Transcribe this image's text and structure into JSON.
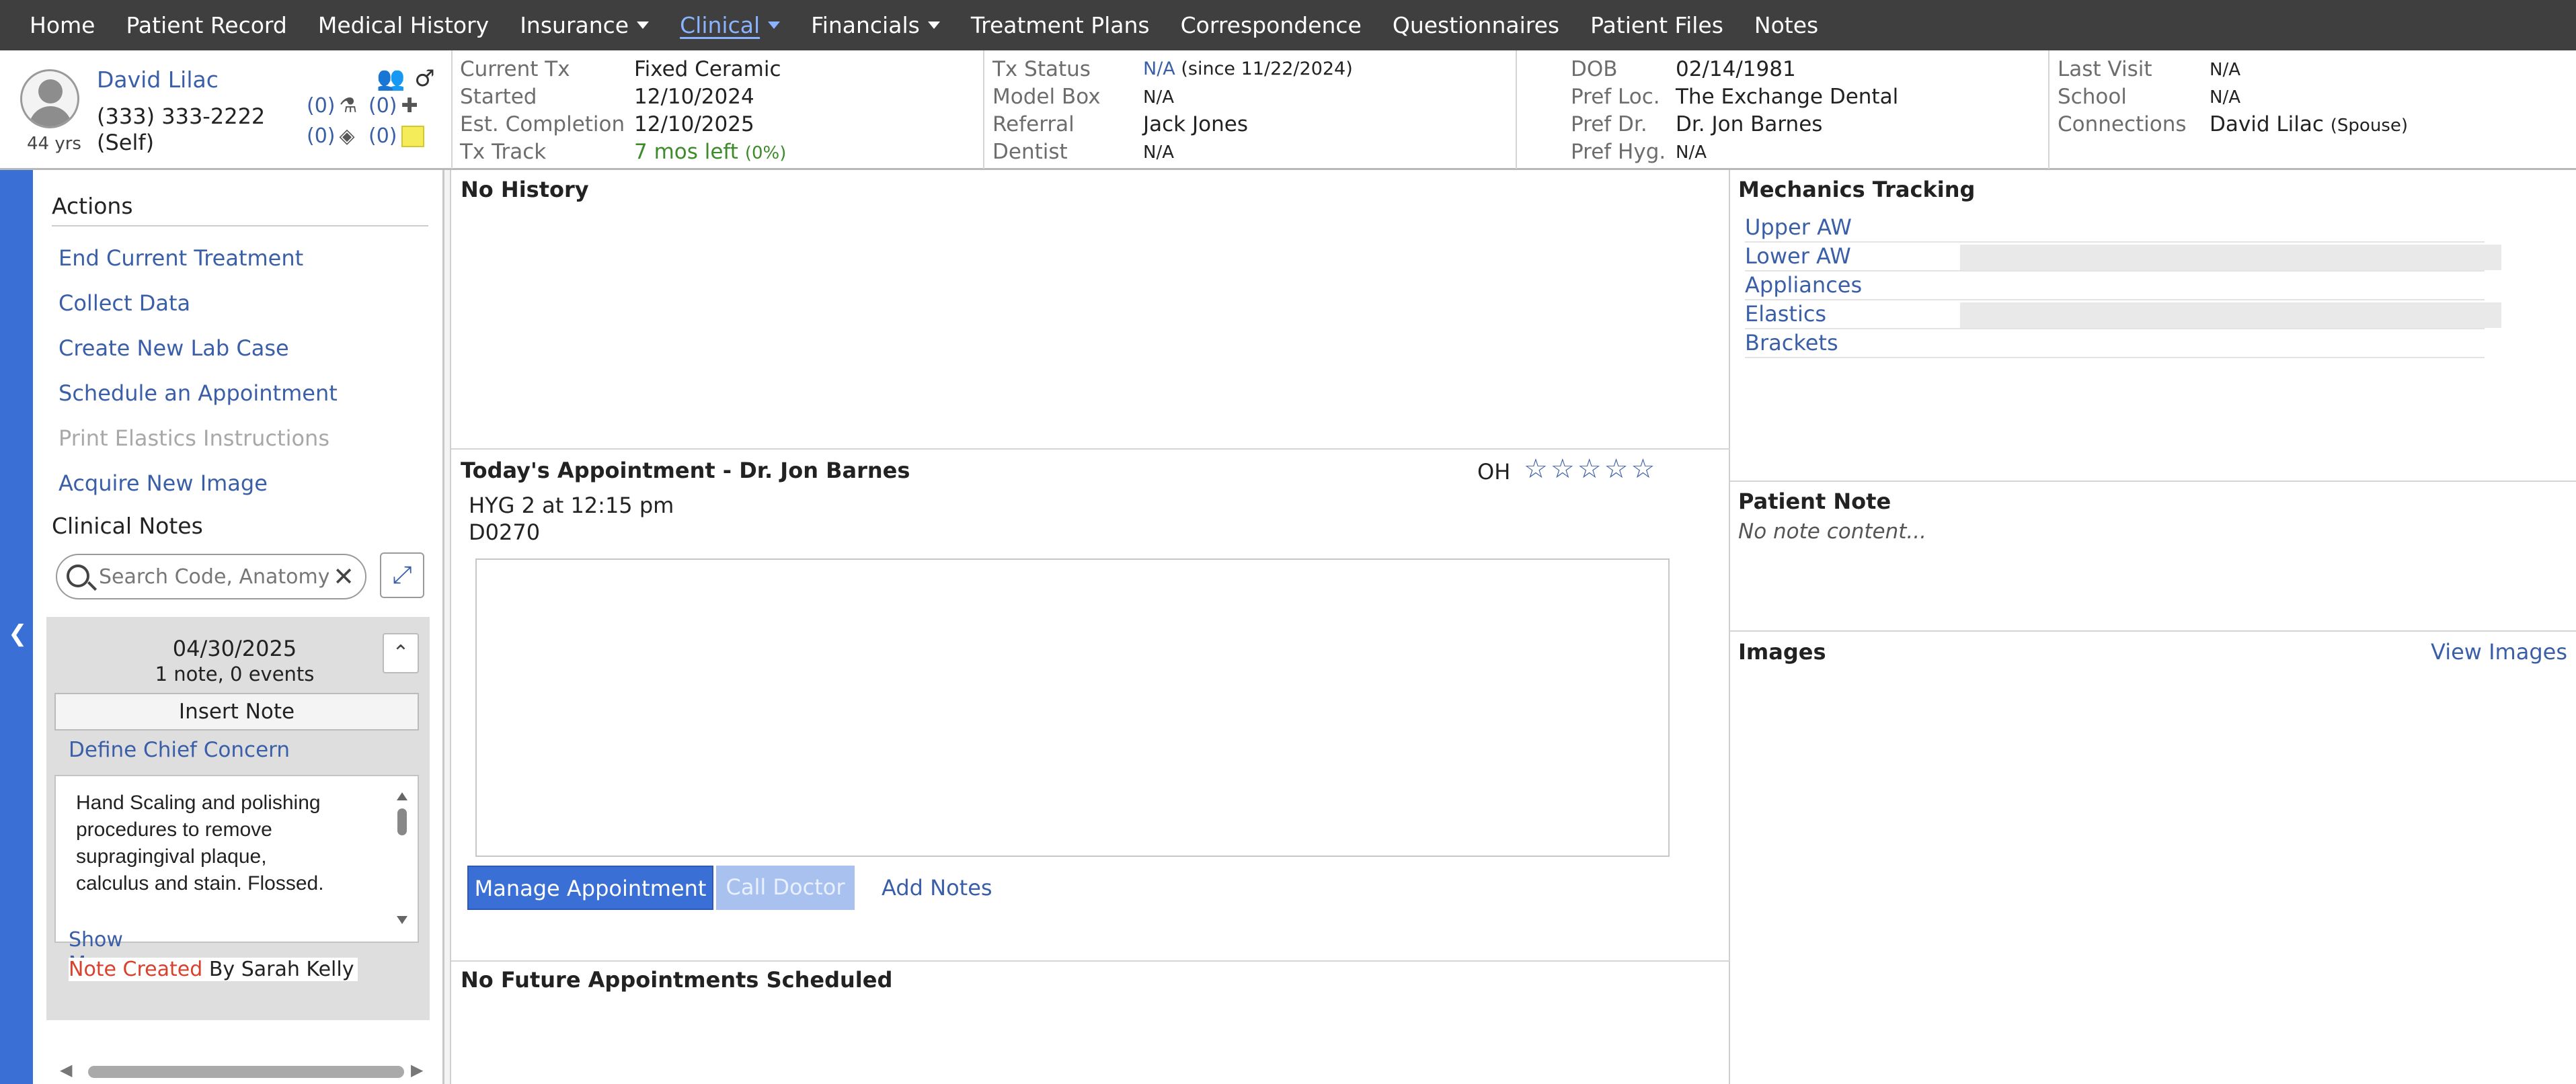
{
  "nav": {
    "items": [
      {
        "label": "Home"
      },
      {
        "label": "Patient Record"
      },
      {
        "label": "Medical History"
      },
      {
        "label": "Insurance",
        "dropdown": true
      },
      {
        "label": "Clinical",
        "dropdown": true,
        "active": true
      },
      {
        "label": "Financials",
        "dropdown": true
      },
      {
        "label": "Treatment Plans"
      },
      {
        "label": "Correspondence"
      },
      {
        "label": "Questionnaires"
      },
      {
        "label": "Patient Files"
      },
      {
        "label": "Notes"
      }
    ]
  },
  "patient": {
    "name": "David Lilac",
    "phone": "(333) 333-2222",
    "relation": "(Self)",
    "age": "44 yrs",
    "counts": {
      "lab": "(0)",
      "med": "(0)",
      "tags": "(0)",
      "notes": "(0)"
    }
  },
  "header": {
    "col1": [
      {
        "label": "Current Tx",
        "value": "Fixed Ceramic"
      },
      {
        "label": "Started",
        "value": "12/10/2024"
      },
      {
        "label": "Est. Completion",
        "value": "12/10/2025"
      },
      {
        "label": "Tx Track",
        "value": "7 mos left",
        "extra": "(0%)"
      }
    ],
    "col2": [
      {
        "label": "Tx Status",
        "value": "N/A",
        "extra": "(since 11/22/2024)"
      },
      {
        "label": "Model Box",
        "value": "N/A"
      },
      {
        "label": "Referral",
        "value": "Jack Jones"
      },
      {
        "label": "Dentist",
        "value": "N/A"
      }
    ],
    "col3": [
      {
        "label": "DOB",
        "value": "02/14/1981"
      },
      {
        "label": "Pref Loc.",
        "value": "The Exchange Dental"
      },
      {
        "label": "Pref Dr.",
        "value": "Dr. Jon Barnes"
      },
      {
        "label": "Pref Hyg.",
        "value": "N/A"
      }
    ],
    "col4": [
      {
        "label": "Last Visit",
        "value": "N/A"
      },
      {
        "label": "School",
        "value": "N/A"
      },
      {
        "label": "Connections",
        "value": "David Lilac",
        "extra": "(Spouse)"
      }
    ]
  },
  "actions": {
    "title": "Actions",
    "items": [
      {
        "label": "End Current Treatment",
        "enabled": true
      },
      {
        "label": "Collect Data",
        "enabled": true
      },
      {
        "label": "Create New Lab Case",
        "enabled": true
      },
      {
        "label": "Schedule an Appointment",
        "enabled": true
      },
      {
        "label": "Print Elastics Instructions",
        "enabled": false
      },
      {
        "label": "Acquire New Image",
        "enabled": true
      }
    ]
  },
  "clinical_notes": {
    "title": "Clinical Notes",
    "search_placeholder": "Search Code, Anatomy",
    "date": "04/30/2025",
    "summary": "1 note,  0 events",
    "insert_label": "Insert Note",
    "chief_concern": "Define Chief Concern",
    "note_text": "Hand Scaling and polishing procedures to remove supragingival plaque, calculus and stain. Flossed.",
    "show_more": "Show More",
    "created_label": "Note Created",
    "created_by": "By Sarah Kelly"
  },
  "history": {
    "title": "No History"
  },
  "appointment": {
    "title": "Today's Appointment - Dr. Jon Barnes",
    "oh": "OH",
    "rating": "☆☆☆☆☆",
    "line1": "HYG 2 at 12:15 pm",
    "line2": "D0270",
    "manage_label": "Manage Appointment",
    "call_label": "Call Doctor",
    "add_notes_label": "Add Notes"
  },
  "future": {
    "title": "No Future Appointments Scheduled"
  },
  "mechanics": {
    "title": "Mechanics Tracking",
    "items": [
      {
        "label": "Upper AW",
        "bar": false
      },
      {
        "label": "Lower AW",
        "bar": true
      },
      {
        "label": "Appliances",
        "bar": false
      },
      {
        "label": "Elastics",
        "bar": true
      },
      {
        "label": "Brackets",
        "bar": false
      }
    ]
  },
  "patient_note": {
    "title": "Patient Note",
    "content": "No note content..."
  },
  "images": {
    "title": "Images",
    "link": "View Images"
  },
  "colors": {
    "nav_bg": "#3f3f3f",
    "accent": "#3a6fd6",
    "link": "#3a5fa8",
    "active_nav": "#8ab4ff"
  }
}
